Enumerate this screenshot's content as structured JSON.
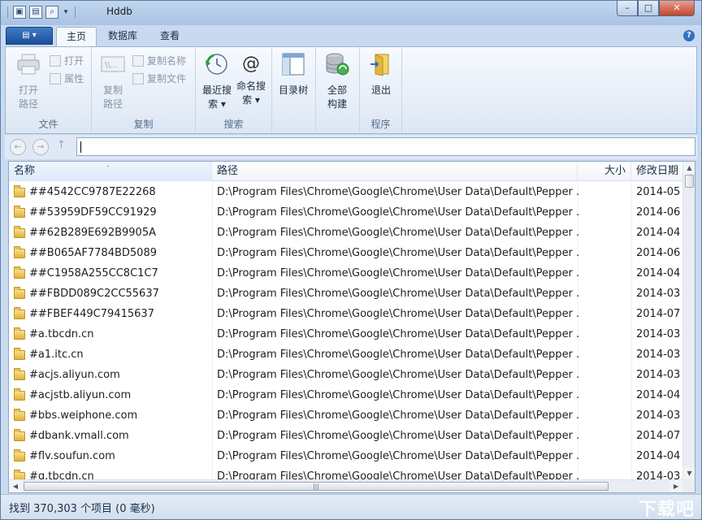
{
  "window": {
    "title": "Hddb",
    "controls": {
      "minimize": "–",
      "maximize": "□",
      "close": "✕"
    }
  },
  "quick_access": {
    "dropdown": "▾"
  },
  "ribbon": {
    "app_menu": "▤ ▾",
    "tabs": [
      {
        "label": "主页",
        "active": true
      },
      {
        "label": "数据库"
      },
      {
        "label": "查看"
      }
    ],
    "help": "?",
    "groups": {
      "file": {
        "label": "文件",
        "open_path": "打开路径",
        "open": "打开",
        "properties": "属性"
      },
      "copy": {
        "label": "复制",
        "copy_path": "复制路径",
        "copy_name": "复制名称",
        "copy_file": "复制文件"
      },
      "search": {
        "label": "搜索",
        "recent_search": "最近搜索 ▾",
        "name_search": "命名搜索 ▾",
        "at_symbol": "@"
      },
      "tree": {
        "directory_tree": "目录树"
      },
      "build": {
        "full_build": "全部构建"
      },
      "program": {
        "label": "程序",
        "exit": "退出"
      }
    }
  },
  "nav": {
    "back": "←",
    "forward": "→",
    "up": "↑",
    "address": ""
  },
  "columns": {
    "name": "名称",
    "path": "路径",
    "size": "大小",
    "modified": "修改日期",
    "sort_arrow": "ˆ"
  },
  "rows": [
    {
      "name": "##4542CC9787E22268",
      "path": "D:\\Program Files\\Chrome\\Google\\Chrome\\User Data\\Default\\Pepper ...",
      "size": "",
      "date": "2014-05"
    },
    {
      "name": "##53959DF59CC91929",
      "path": "D:\\Program Files\\Chrome\\Google\\Chrome\\User Data\\Default\\Pepper ...",
      "size": "",
      "date": "2014-06"
    },
    {
      "name": "##62B289E692B9905A",
      "path": "D:\\Program Files\\Chrome\\Google\\Chrome\\User Data\\Default\\Pepper ...",
      "size": "",
      "date": "2014-04"
    },
    {
      "name": "##B065AF7784BD5089",
      "path": "D:\\Program Files\\Chrome\\Google\\Chrome\\User Data\\Default\\Pepper ...",
      "size": "",
      "date": "2014-06"
    },
    {
      "name": "##C1958A255CC8C1C7",
      "path": "D:\\Program Files\\Chrome\\Google\\Chrome\\User Data\\Default\\Pepper ...",
      "size": "",
      "date": "2014-04"
    },
    {
      "name": "##FBDD089C2CC55637",
      "path": "D:\\Program Files\\Chrome\\Google\\Chrome\\User Data\\Default\\Pepper ...",
      "size": "",
      "date": "2014-03"
    },
    {
      "name": "##FBEF449C79415637",
      "path": "D:\\Program Files\\Chrome\\Google\\Chrome\\User Data\\Default\\Pepper ...",
      "size": "",
      "date": "2014-07"
    },
    {
      "name": "#a.tbcdn.cn",
      "path": "D:\\Program Files\\Chrome\\Google\\Chrome\\User Data\\Default\\Pepper ...",
      "size": "",
      "date": "2014-03"
    },
    {
      "name": "#a1.itc.cn",
      "path": "D:\\Program Files\\Chrome\\Google\\Chrome\\User Data\\Default\\Pepper ...",
      "size": "",
      "date": "2014-03"
    },
    {
      "name": "#acjs.aliyun.com",
      "path": "D:\\Program Files\\Chrome\\Google\\Chrome\\User Data\\Default\\Pepper ...",
      "size": "",
      "date": "2014-03"
    },
    {
      "name": "#acjstb.aliyun.com",
      "path": "D:\\Program Files\\Chrome\\Google\\Chrome\\User Data\\Default\\Pepper ...",
      "size": "",
      "date": "2014-04"
    },
    {
      "name": "#bbs.weiphone.com",
      "path": "D:\\Program Files\\Chrome\\Google\\Chrome\\User Data\\Default\\Pepper ...",
      "size": "",
      "date": "2014-03"
    },
    {
      "name": "#dbank.vmall.com",
      "path": "D:\\Program Files\\Chrome\\Google\\Chrome\\User Data\\Default\\Pepper ...",
      "size": "",
      "date": "2014-07"
    },
    {
      "name": "#flv.soufun.com",
      "path": "D:\\Program Files\\Chrome\\Google\\Chrome\\User Data\\Default\\Pepper ...",
      "size": "",
      "date": "2014-04"
    },
    {
      "name": "#g.tbcdn.cn",
      "path": "D:\\Program Files\\Chrome\\Google\\Chrome\\User Data\\Default\\Pepper ...",
      "size": "",
      "date": "2014-03"
    }
  ],
  "scrollbars": {
    "up": "▲",
    "down": "▼",
    "left": "◀",
    "right": "▶",
    "grip": "|||"
  },
  "status": {
    "text": "找到 370,303 个项目 (0 毫秒)"
  },
  "watermark": "下载吧"
}
